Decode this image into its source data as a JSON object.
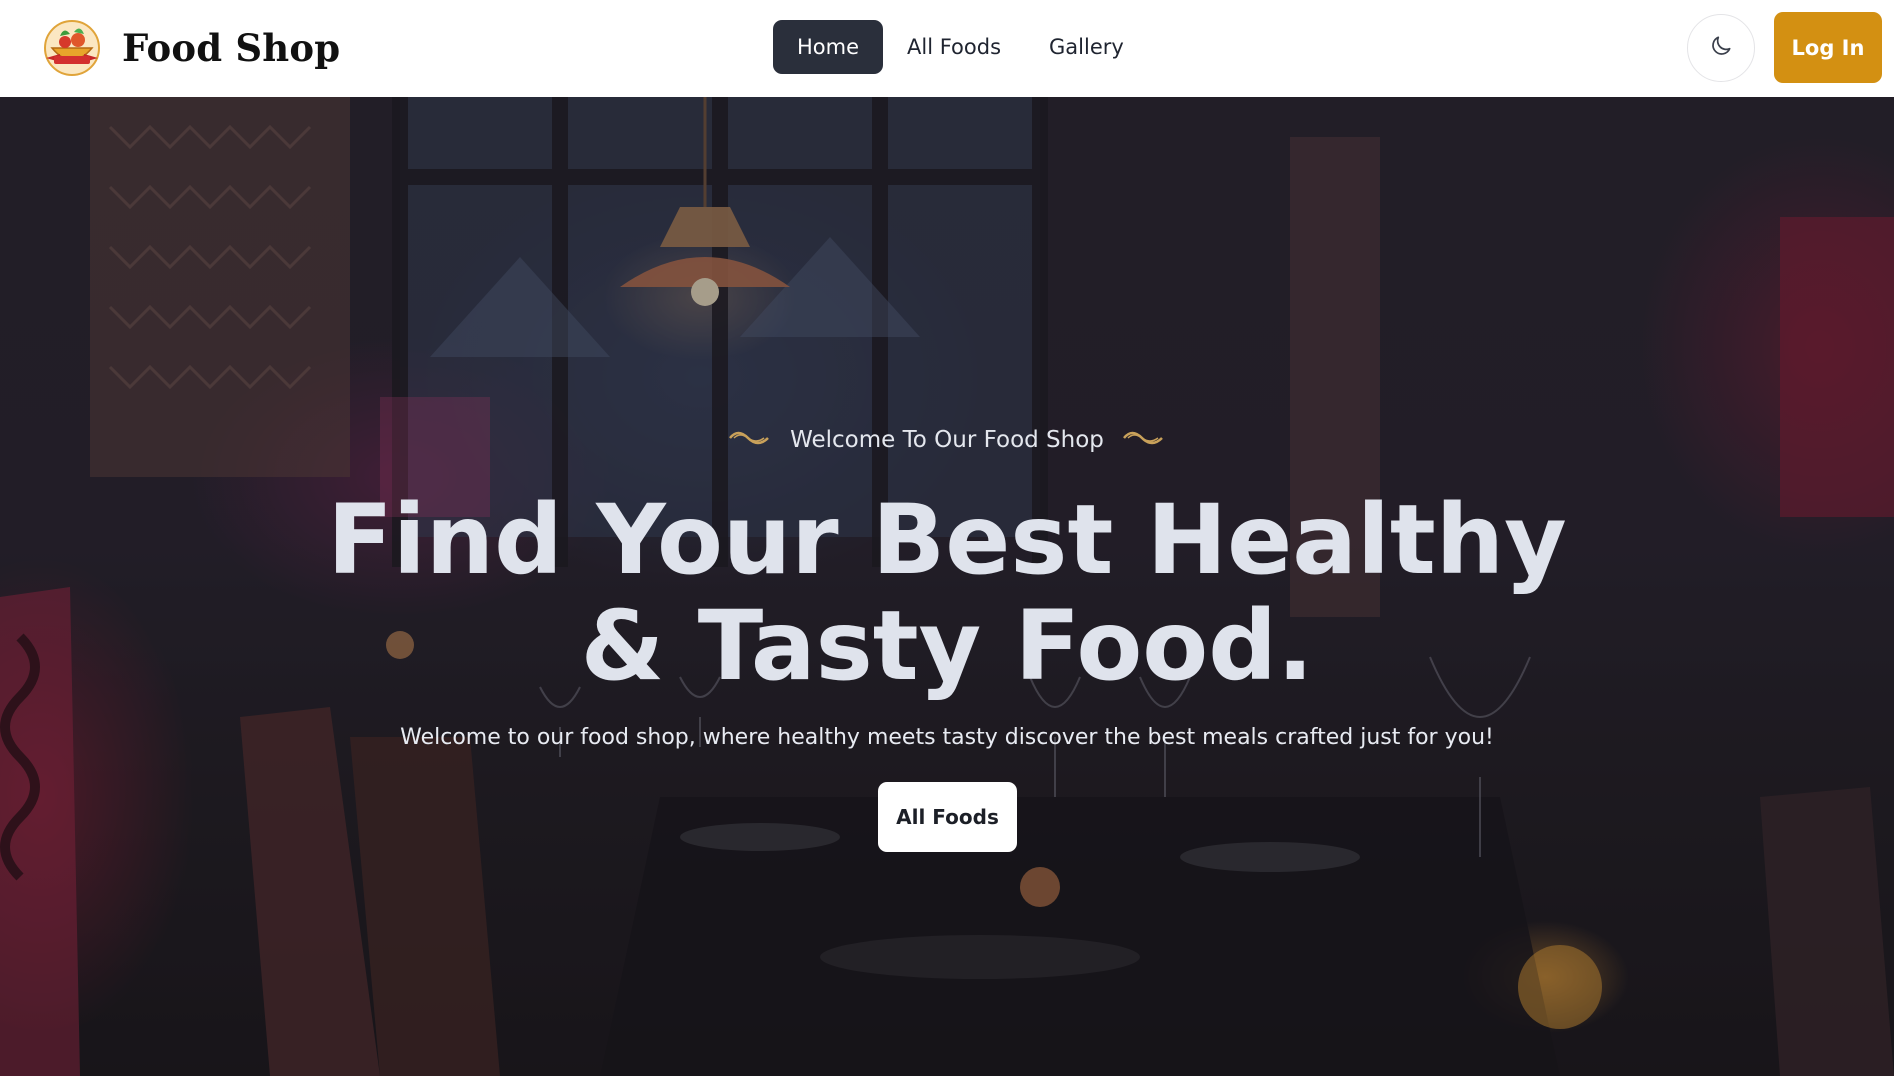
{
  "navbar": {
    "brand_name": "Food Shop",
    "logo_icon": "food-bowl-logo",
    "links": [
      {
        "label": "Home",
        "active": true
      },
      {
        "label": "All Foods",
        "active": false
      },
      {
        "label": "Gallery",
        "active": false
      }
    ],
    "theme_toggle_icon": "moon-icon",
    "login_label": "Log In"
  },
  "hero": {
    "eyebrow": "Welcome To Our Food Shop",
    "title_line1": "Find Your Best Healthy",
    "title_line2": "& Tasty Food.",
    "subtitle": "Welcome to our food shop, where healthy meets tasty discover the best meals crafted just for you!",
    "cta_label": "All Foods",
    "background_image": "restaurant-interior-photo"
  },
  "colors": {
    "accent": "#d39012",
    "nav_active": "#2a2f3b",
    "ornament": "#c9a15a"
  }
}
